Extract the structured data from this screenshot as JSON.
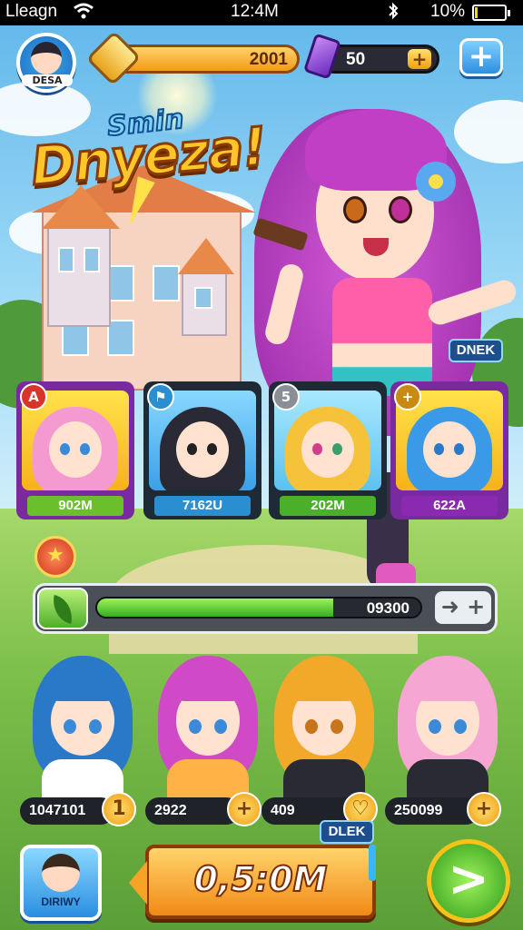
{
  "status_bar": {
    "carrier": "Lleagn",
    "time": "12:4M",
    "battery_percent": "10%",
    "battery_level": 0.1
  },
  "hud": {
    "avatar_label": "DESA",
    "gold_value": "2001",
    "gem_value": "50",
    "gem_plus": "+",
    "add_label": "+"
  },
  "title": {
    "subtitle": "Smin",
    "main": "Dnyeza!"
  },
  "hero_tag": "DNEK",
  "cards": [
    {
      "value": "902M",
      "badge": "A",
      "frame_color": "#7a2aa0",
      "label_color": "#6abf2a"
    },
    {
      "value": "7162U",
      "badge": "⚑",
      "frame_color": "#1e2a36",
      "label_color": "#2a8ed0"
    },
    {
      "value": "202M",
      "badge": "5",
      "frame_color": "#1e2a36",
      "label_color": "#4ab02a"
    },
    {
      "value": "622A",
      "badge": "+",
      "frame_color": "#7a2aa0",
      "label_color": "#8a2ab0"
    }
  ],
  "progress": {
    "value_label": "09300",
    "fill_fraction": 0.73,
    "arrows_label": "➜ +"
  },
  "team": [
    {
      "value": "1047101",
      "button": "1",
      "hair": "#2a78c8",
      "eye": "#3a8ad8",
      "body": "#ffffff"
    },
    {
      "value": "2922",
      "button": "+",
      "hair": "#d04ac8",
      "eye": "#3a8ad8",
      "body": "#ffb347"
    },
    {
      "value": "409",
      "button": "♡",
      "hair": "#f2a92a",
      "eye": "#c8741a",
      "body": "#2a2a34"
    },
    {
      "value": "250099",
      "button": "+",
      "hair": "#f5a6d2",
      "eye": "#3a8ad8",
      "body": "#2a2a34"
    }
  ],
  "bottom": {
    "tag": "DLEK",
    "profile_label": "DIRIWY",
    "timer_value": "0,5:0M",
    "go_label": ">"
  },
  "colors": {
    "accent_orange": "#f39a16",
    "accent_green": "#34b01e",
    "accent_blue": "#2f8fe0",
    "accent_purple": "#7a2aa0"
  }
}
